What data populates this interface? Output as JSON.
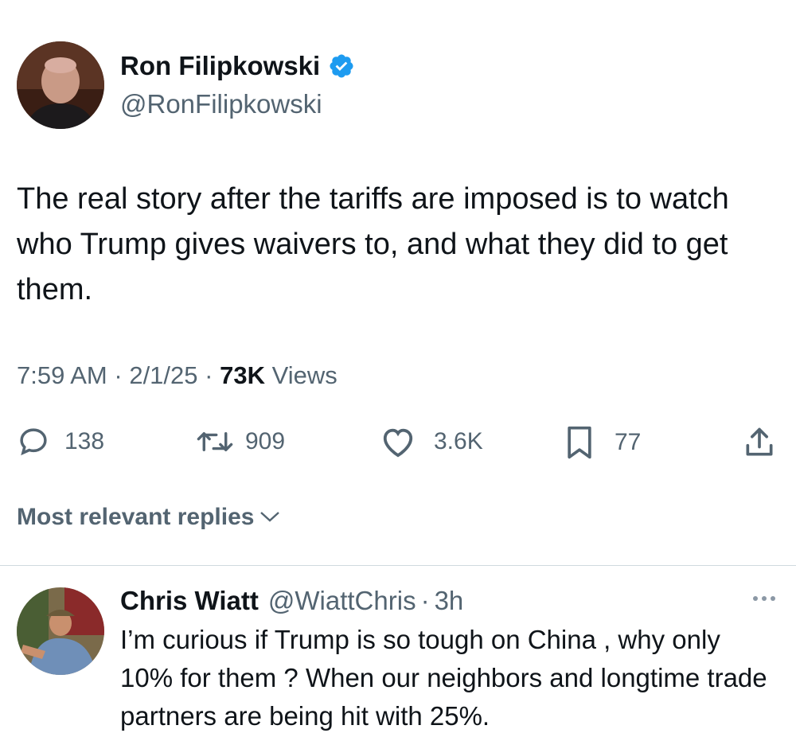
{
  "tweet": {
    "author_name": "Ron Filipkowski",
    "author_handle": "@RonFilipkowski",
    "text": "The real story after the tariffs are imposed is to watch who Trump gives waivers to, and what they did to get them.",
    "time": "7:59 AM",
    "date": "2/1/25",
    "separator": "·",
    "views_count": "73K",
    "views_label": "Views"
  },
  "actions": {
    "replies": "138",
    "reposts": "909",
    "likes": "3.6K",
    "bookmarks": "77"
  },
  "replies_sort": {
    "label": "Most relevant replies"
  },
  "reply": {
    "author_name": "Chris Wiatt",
    "author_handle": "@WiattChris",
    "separator": "·",
    "time": "3h",
    "text": "I’m curious if Trump is so tough on China , why only 10% for them ? When our neighbors and longtime trade partners are being hit with 25%."
  },
  "colors": {
    "verified_badge": "#1d9bf0",
    "secondary_text": "#536471",
    "primary_text": "#0f1419",
    "divider": "#cfd9de"
  },
  "icons": {
    "verified": "verified-badge-icon",
    "reply": "speech-bubble-icon",
    "repost": "repost-arrows-icon",
    "like": "heart-icon",
    "bookmark": "bookmark-icon",
    "share": "share-upload-icon",
    "sort": "chevron-down-icon",
    "more": "more-dots-icon"
  }
}
